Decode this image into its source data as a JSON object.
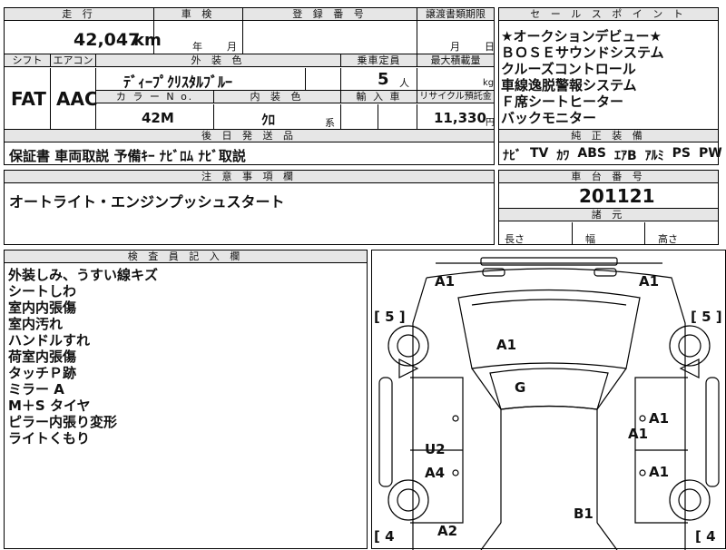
{
  "main": {
    "mileage_label": "走 行",
    "mileage_value": "42,047",
    "mileage_unit": "km",
    "shaken_label": "車 検",
    "shaken_year": "年",
    "shaken_month": "月",
    "reg_label": "登 録 番 号",
    "transfer_label": "譲渡書類期限",
    "transfer_month": "月",
    "transfer_day": "日",
    "shift_label": "シフト",
    "shift_value": "FAT",
    "ac_label": "エアコン",
    "ac_value": "AAC",
    "exterior_label": "外 装 色",
    "exterior_value": "ﾃﾞｨｰﾌﾟｸﾘｽﾀﾙﾌﾞﾙｰ",
    "capacity_label": "乗車定員",
    "capacity_value": "5",
    "capacity_unit": "人",
    "maxload_label": "最大積載量",
    "maxload_unit": "kg",
    "colorno_label": "カ ラ ー N o.",
    "colorno_value": "42M",
    "interior_label": "内 装 色",
    "interior_value": "ｸﾛ",
    "interior_suffix": "系",
    "import_label": "輸 入 車",
    "recycle_label": "リサイクル預託金",
    "recycle_value": "11,330",
    "recycle_unit": "円"
  },
  "sales_points": {
    "label": "セ ー ル ス ポ イ ン ト",
    "items": [
      "★オークションデビュー★",
      "ＢＯＳＥサウンドシステム",
      "クルーズコントロール",
      "車線逸脱警報システム",
      "Ｆ席シートヒーター",
      "バックモニター"
    ]
  },
  "genuine": {
    "label": "純 正 装 備",
    "items": [
      "ﾅﾋﾞ",
      "TV",
      "ｶﾜ",
      "ABS",
      "ｴｱB",
      "ｱﾙﾐ",
      "PS",
      "PW"
    ]
  },
  "post_ship": {
    "label": "後 日 発 送 品",
    "value": "保証書 車両取説 予備ｷｰ ﾅﾋﾞﾛﾑ ﾅﾋﾞ取説"
  },
  "caution": {
    "label": "注 意 事 項 欄",
    "value": "オートライト・エンジンプッシュスタート"
  },
  "chassis": {
    "label": "車 台 番 号",
    "value": "201121"
  },
  "specs": {
    "label": "諸 元",
    "length": "長さ",
    "width": "幅",
    "height": "高さ"
  },
  "inspector": {
    "label": "検 査 員 記 入 欄",
    "notes": [
      "外装しみ、うすい線キズ",
      "シートしわ",
      "室内内張傷",
      "室内汚れ",
      "ハンドルすれ",
      "荷室内張傷",
      "タッチＰ跡",
      "ミラー A",
      "M＋S タイヤ",
      "ピラー内張り変形",
      "ライトくもり"
    ]
  },
  "diagram": {
    "damage_marks": [
      {
        "name": "a1-front-left",
        "text": "A1"
      },
      {
        "name": "a1-front-right",
        "text": "A1"
      },
      {
        "name": "a1-hood",
        "text": "A1"
      },
      {
        "name": "g-windshield",
        "text": "G"
      },
      {
        "name": "a1-right-upper",
        "text": "A1"
      },
      {
        "name": "a1-right-mid",
        "text": "A1"
      },
      {
        "name": "a1-right-lower",
        "text": "A1"
      },
      {
        "name": "u2-left",
        "text": "U2"
      },
      {
        "name": "a4-left",
        "text": "A4"
      },
      {
        "name": "b1-rear",
        "text": "B1"
      },
      {
        "name": "a2-rear-left",
        "text": "A2"
      }
    ],
    "tire_marks": [
      {
        "name": "tire-front-left",
        "text": "[ 5 ]"
      },
      {
        "name": "tire-front-right",
        "text": "[ 5 ]"
      },
      {
        "name": "tire-rear-left",
        "text": "[ 4"
      },
      {
        "name": "tire-rear-right",
        "text": "[ 4"
      }
    ]
  }
}
